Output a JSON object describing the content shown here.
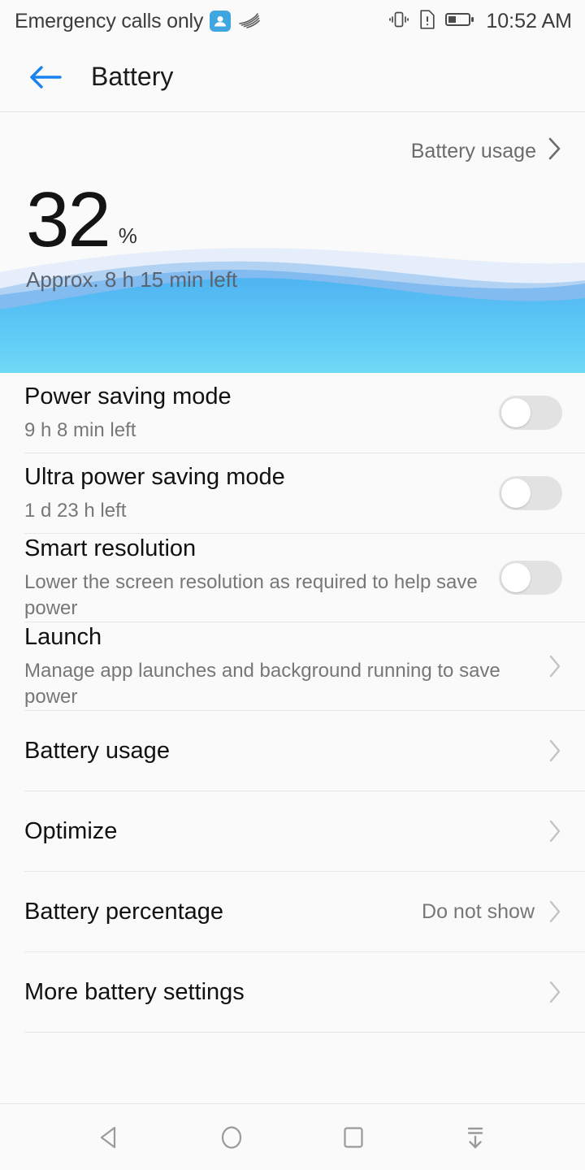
{
  "statusbar": {
    "carrier": "Emergency calls only",
    "time": "10:52 AM",
    "icons": {
      "app_badge": "contact-app-icon",
      "signal_swoosh": "signal-swoosh-icon",
      "vibrate": "vibrate-icon",
      "sim_alert": "sim-card-alert-icon",
      "battery": "battery-icon"
    },
    "battery_fill_percent": 32
  },
  "header": {
    "title": "Battery",
    "back_icon": "back-arrow-icon",
    "accent_color": "#1a82ef"
  },
  "hero": {
    "usage_link_label": "Battery usage",
    "percent_value": "32",
    "percent_sign": "%",
    "time_remaining": "Approx. 8 h 15 min left",
    "wave_colors": {
      "back": "#e6eefb",
      "mid": "#7bb8ef",
      "front_top": "#4fb4f2",
      "front_bottom": "#6fd9f7"
    }
  },
  "settings": [
    {
      "name": "power-saving-mode",
      "title": "Power saving mode",
      "subtitle": "9 h 8 min left",
      "control": "toggle",
      "value": "",
      "enabled": false
    },
    {
      "name": "ultra-power-saving-mode",
      "title": "Ultra power saving mode",
      "subtitle": "1 d 23 h left",
      "control": "toggle",
      "value": "",
      "enabled": false
    },
    {
      "name": "smart-resolution",
      "title": "Smart resolution",
      "subtitle": "Lower the screen resolution as required to help save power",
      "control": "toggle",
      "value": "",
      "enabled": false
    },
    {
      "name": "launch",
      "title": "Launch",
      "subtitle": "Manage app launches and background running to save power",
      "control": "chevron",
      "value": ""
    },
    {
      "name": "battery-usage",
      "title": "Battery usage",
      "subtitle": "",
      "control": "chevron",
      "value": ""
    },
    {
      "name": "optimize",
      "title": "Optimize",
      "subtitle": "",
      "control": "chevron",
      "value": ""
    },
    {
      "name": "battery-percentage",
      "title": "Battery percentage",
      "subtitle": "",
      "control": "chevron",
      "value": "Do not show"
    },
    {
      "name": "more-battery-settings",
      "title": "More battery settings",
      "subtitle": "",
      "control": "chevron",
      "value": ""
    }
  ],
  "navbar": {
    "buttons": [
      {
        "name": "nav-back-button",
        "icon": "back-triangle-icon"
      },
      {
        "name": "nav-home-button",
        "icon": "home-circle-icon"
      },
      {
        "name": "nav-recents-button",
        "icon": "recents-square-icon"
      },
      {
        "name": "nav-notification-shade-button",
        "icon": "pull-down-arrow-icon"
      }
    ]
  }
}
